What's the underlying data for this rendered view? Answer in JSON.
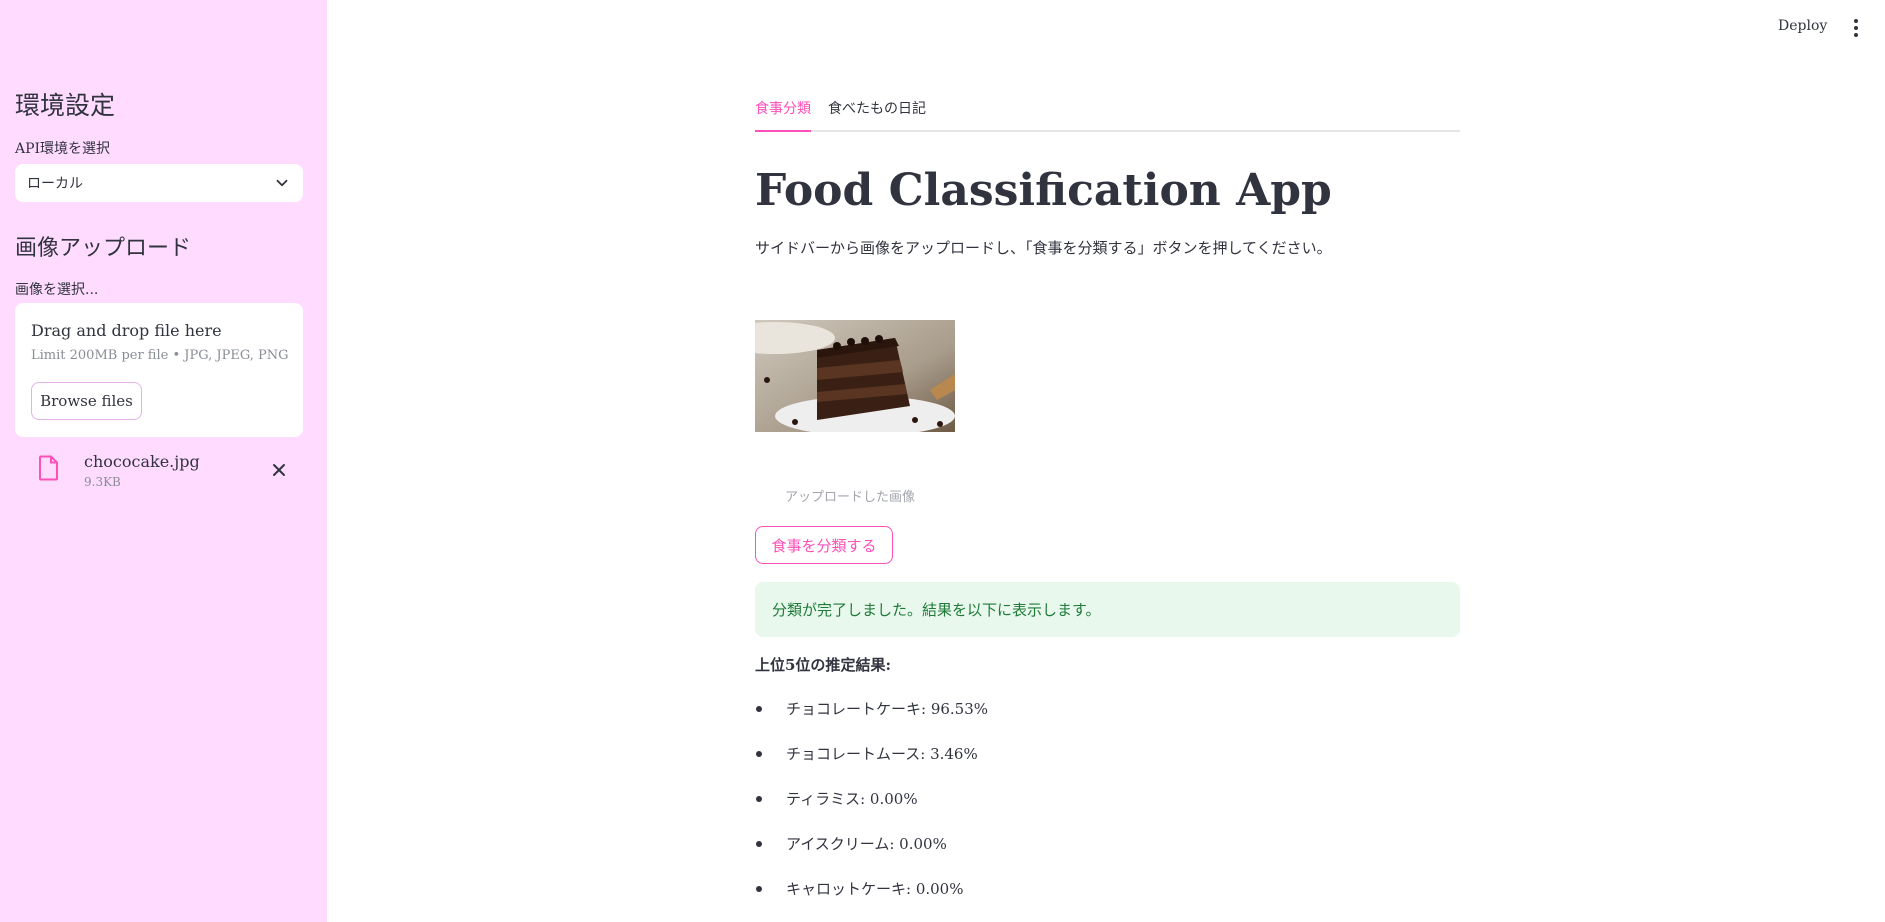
{
  "header": {
    "deploy_label": "Deploy",
    "menu_icon": "more-vertical-icon"
  },
  "sidebar": {
    "env_heading": "環境設定",
    "api_label": "API環境を選択",
    "api_selected": "ローカル",
    "upload_heading": "画像アップロード",
    "image_label": "画像を選択...",
    "uploader": {
      "drag_text": "Drag and drop file here",
      "limit_text": "Limit 200MB per file • JPG, JPEG, PNG",
      "browse_label": "Browse files"
    },
    "file": {
      "name": "chococake.jpg",
      "size": "9.3KB",
      "icon": "file-icon",
      "close_icon": "close-icon"
    }
  },
  "main": {
    "tabs": [
      {
        "label": "食事分類",
        "active": true
      },
      {
        "label": "食べたもの日記",
        "active": false
      }
    ],
    "title": "Food Classification App",
    "subtitle": "サイドバーから画像をアップロードし、「食事を分類する」ボタンを押してください。",
    "image_caption": "アップロードした画像",
    "classify_label": "食事を分類する",
    "success_text": "分類が完了しました。結果を以下に表示します。",
    "results_title": "上位5位の推定結果:",
    "results": [
      "チョコレートケーキ: 96.53%",
      "チョコレートムース: 3.46%",
      "ティラミス: 0.00%",
      "アイスクリーム: 0.00%",
      "キャロットケーキ: 0.00%"
    ]
  },
  "colors": {
    "sidebar_bg": "#ffdcff",
    "accent": "#ff4fb8",
    "success_bg": "#e8f8ec",
    "success_text": "#1f7a3a"
  }
}
